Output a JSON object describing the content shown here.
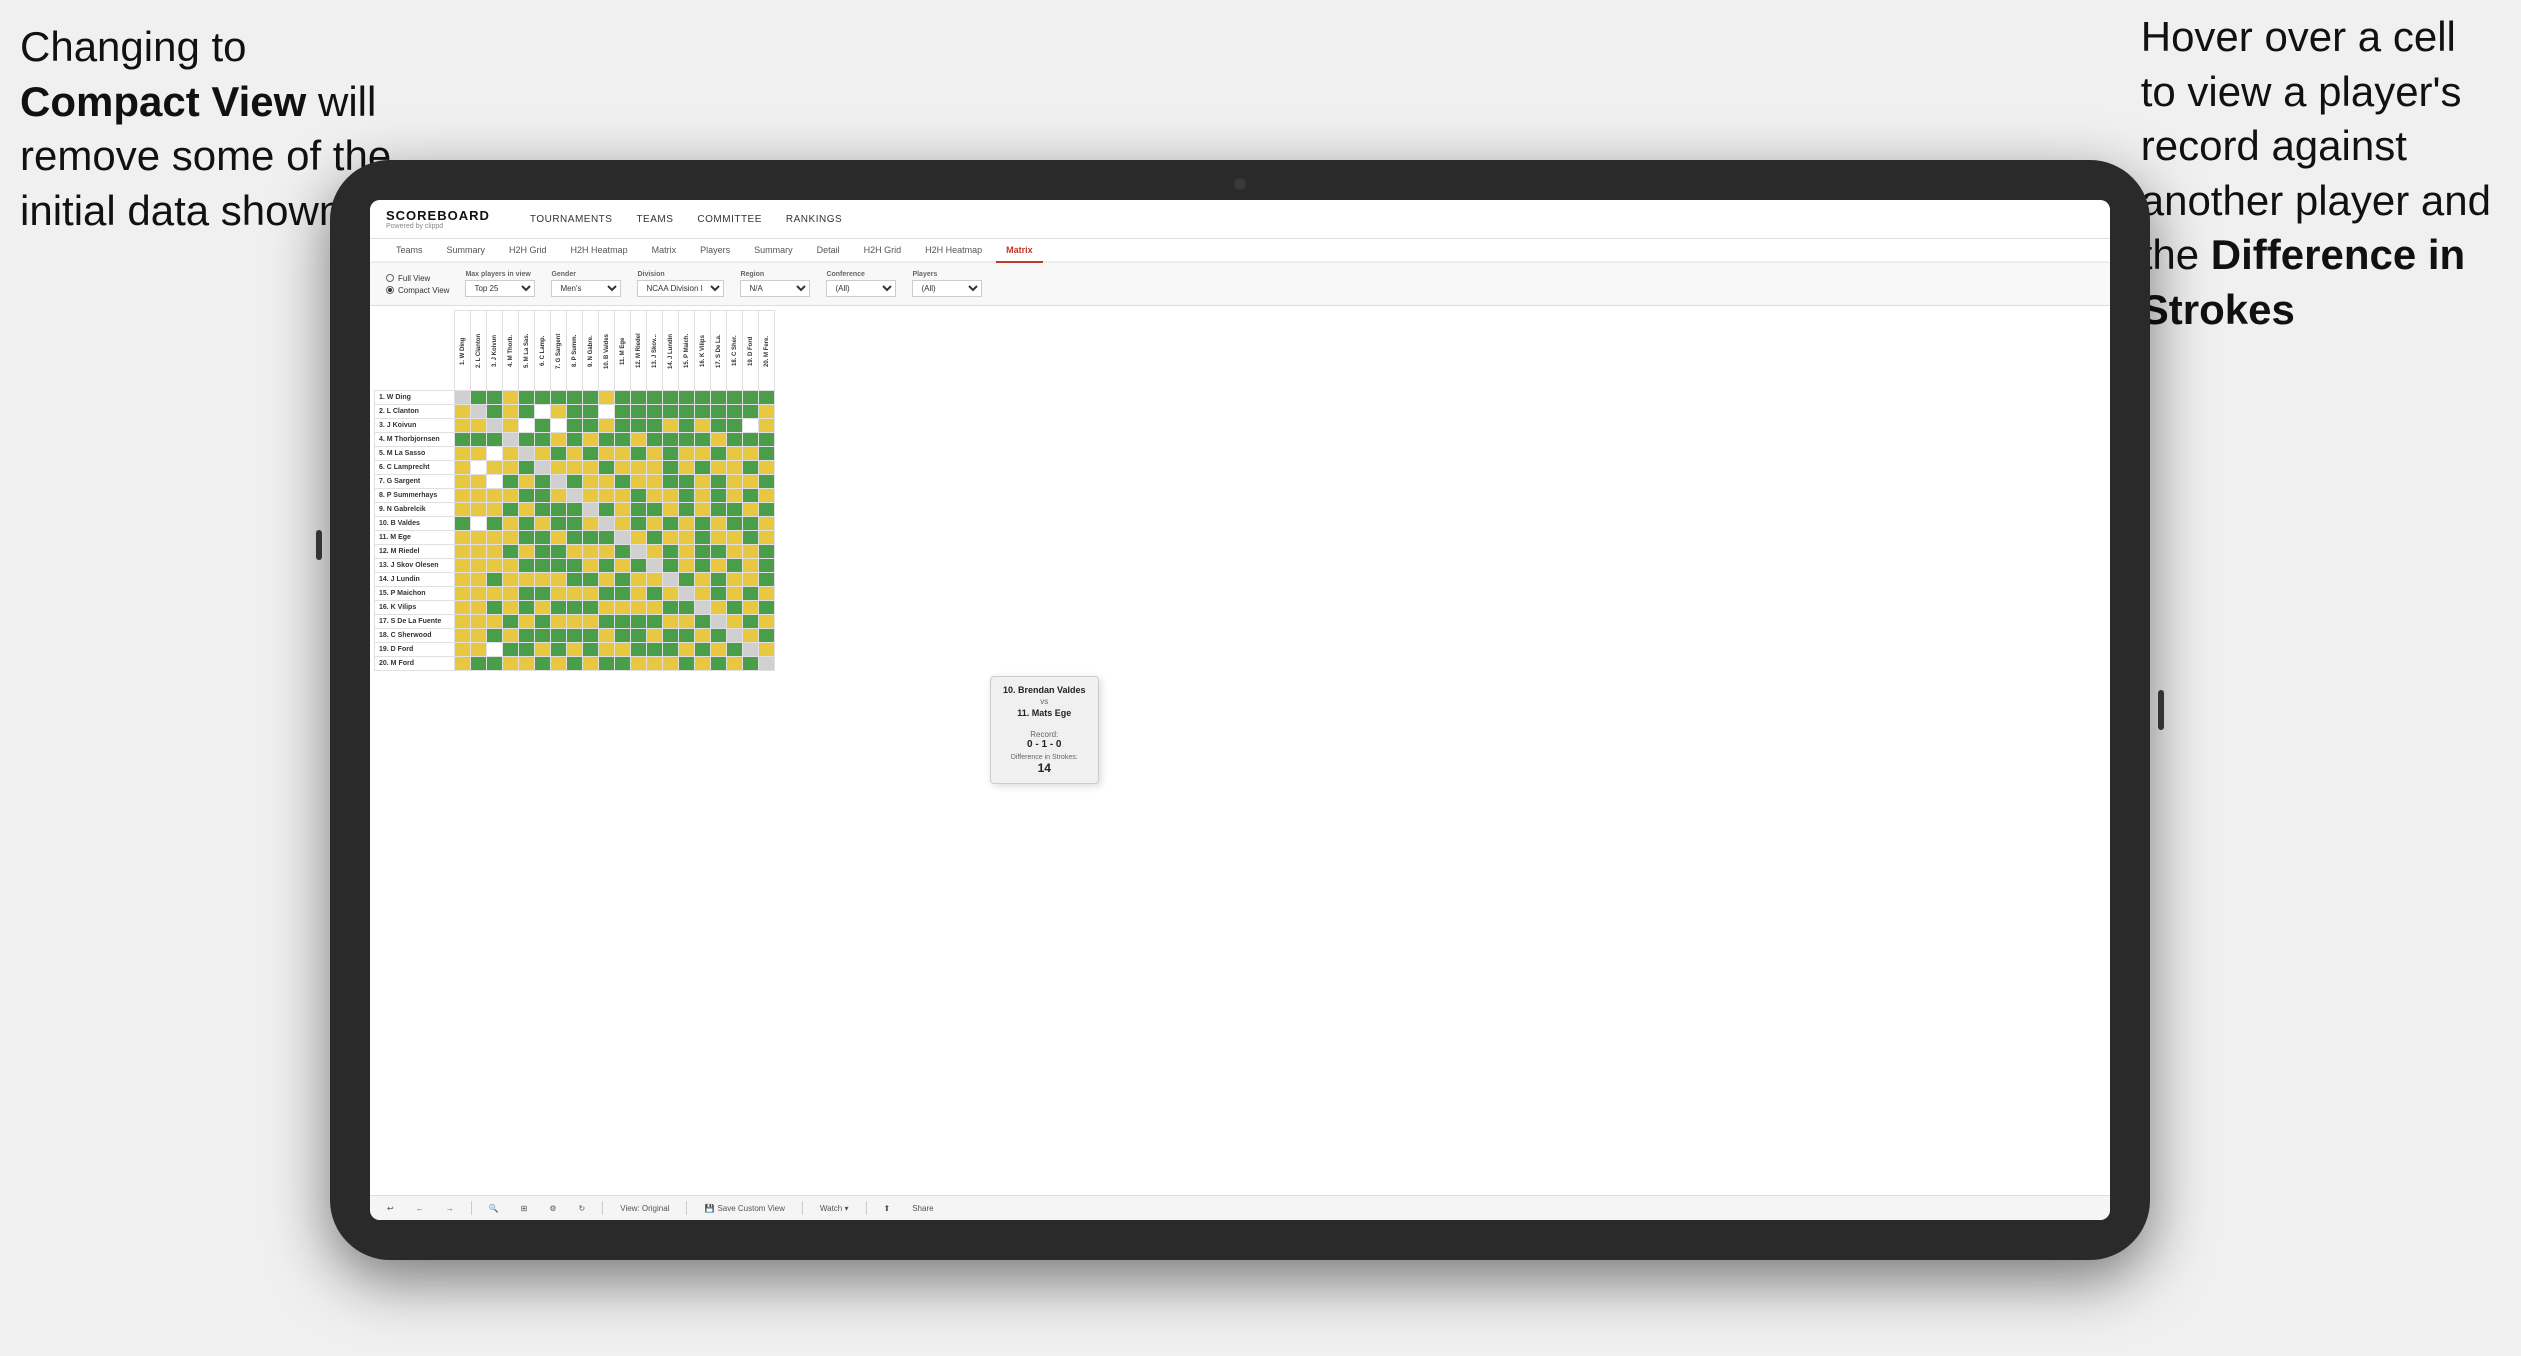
{
  "annotations": {
    "left": {
      "line1": "Changing to",
      "line2_bold": "Compact View",
      "line2_rest": " will",
      "line3": "remove some of the",
      "line4": "initial data shown"
    },
    "right": {
      "line1": "Hover over a cell",
      "line2": "to view a player's",
      "line3": "record against",
      "line4": "another player and",
      "line5_pre": "the ",
      "line5_bold": "Difference in",
      "line6_bold": "Strokes"
    }
  },
  "nav": {
    "logo": "SCOREBOARD",
    "logo_sub": "Powered by clippd",
    "items": [
      "TOURNAMENTS",
      "TEAMS",
      "COMMITTEE",
      "RANKINGS"
    ]
  },
  "tabs1": [
    "Teams",
    "Summary",
    "H2H Grid",
    "H2H Heatmap",
    "Matrix",
    "Players",
    "Summary",
    "Detail",
    "H2H Grid",
    "H2H Heatmap",
    "Matrix"
  ],
  "filters": {
    "view_full": "Full View",
    "view_compact": "Compact View",
    "max_players_label": "Max players in view",
    "max_players_value": "Top 25",
    "gender_label": "Gender",
    "gender_value": "Men's",
    "division_label": "Division",
    "division_value": "NCAA Division I",
    "region_label": "Region",
    "region_value": "N/A",
    "conference_label": "Conference",
    "conference_value": "(All)",
    "players_label": "Players",
    "players_value": "(All)"
  },
  "players": [
    "1. W Ding",
    "2. L Clanton",
    "3. J Koivun",
    "4. M Thorbjornsen",
    "5. M La Sasso",
    "6. C Lamprecht",
    "7. G Sargent",
    "8. P Summerhays",
    "9. N Gabrelcik",
    "10. B Valdes",
    "11. M Ege",
    "12. M Riedel",
    "13. J Skov Olesen",
    "14. J Lundin",
    "15. P Maichon",
    "16. K Vilips",
    "17. S De La Fuente",
    "18. C Sherwood",
    "19. D Ford",
    "20. M Ford"
  ],
  "col_headers": [
    "1. W Ding",
    "2. L Clanton",
    "3. J Koivun",
    "4. M Thorb...",
    "5. M La Sa...",
    "6. C Lamp...",
    "7. G Sargent",
    "8. P Summ...",
    "9. N Gabre...",
    "10. B Valdes",
    "11. M Ege",
    "12. M Riedel",
    "13. J Skov...",
    "14. J Lundin",
    "15. P Maich...",
    "16. K Vilips",
    "17. S De La...",
    "18. C Sher...",
    "19. D Ford",
    "20. M Fere..."
  ],
  "tooltip": {
    "player1": "10. Brendan Valdes",
    "vs": "vs",
    "player2": "11. Mats Ege",
    "record_label": "Record:",
    "record": "0 - 1 - 0",
    "diff_label": "Difference in Strokes:",
    "diff": "14"
  },
  "toolbar": {
    "undo": "↩",
    "redo_left": "⟵",
    "redo_right": "⟶",
    "view_original": "View: Original",
    "save_custom": "Save Custom View",
    "watch": "Watch ▾",
    "share": "Share"
  }
}
